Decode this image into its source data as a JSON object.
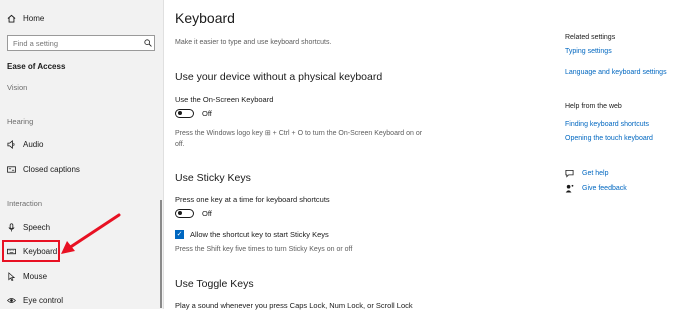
{
  "sidebar": {
    "home": "Home",
    "search_placeholder": "Find a setting",
    "heading": "Ease of Access",
    "sections": {
      "vision": "Vision",
      "hearing": "Hearing",
      "interaction": "Interaction"
    },
    "items": {
      "audio": "Audio",
      "closed_captions": "Closed captions",
      "speech": "Speech",
      "keyboard": "Keyboard",
      "mouse": "Mouse",
      "eye_control": "Eye control"
    }
  },
  "main": {
    "title": "Keyboard",
    "subtitle": "Make it easier to type and use keyboard shortcuts.",
    "osk": {
      "heading": "Use your device without a physical keyboard",
      "label": "Use the On-Screen Keyboard",
      "state": "Off",
      "hint": "Press the Windows logo key ⊞ + Ctrl + O to turn the On-Screen Keyboard on or off."
    },
    "sticky": {
      "heading": "Use Sticky Keys",
      "label": "Press one key at a time for keyboard shortcuts",
      "state": "Off",
      "checkbox_label": "Allow the shortcut key to start Sticky Keys",
      "hint": "Press the Shift key five times to turn Sticky Keys on or off"
    },
    "toggle_keys": {
      "heading": "Use Toggle Keys",
      "label": "Play a sound whenever you press Caps Lock, Num Lock, or Scroll Lock"
    }
  },
  "right": {
    "related_heading": "Related settings",
    "related_links": [
      "Typing settings",
      "Language and keyboard settings"
    ],
    "help_heading": "Help from the web",
    "help_links": [
      "Finding keyboard shortcuts",
      "Opening the touch keyboard"
    ],
    "get_help": "Get help",
    "give_feedback": "Give feedback"
  },
  "colors": {
    "accent": "#0067c0",
    "highlight": "#e81123"
  }
}
